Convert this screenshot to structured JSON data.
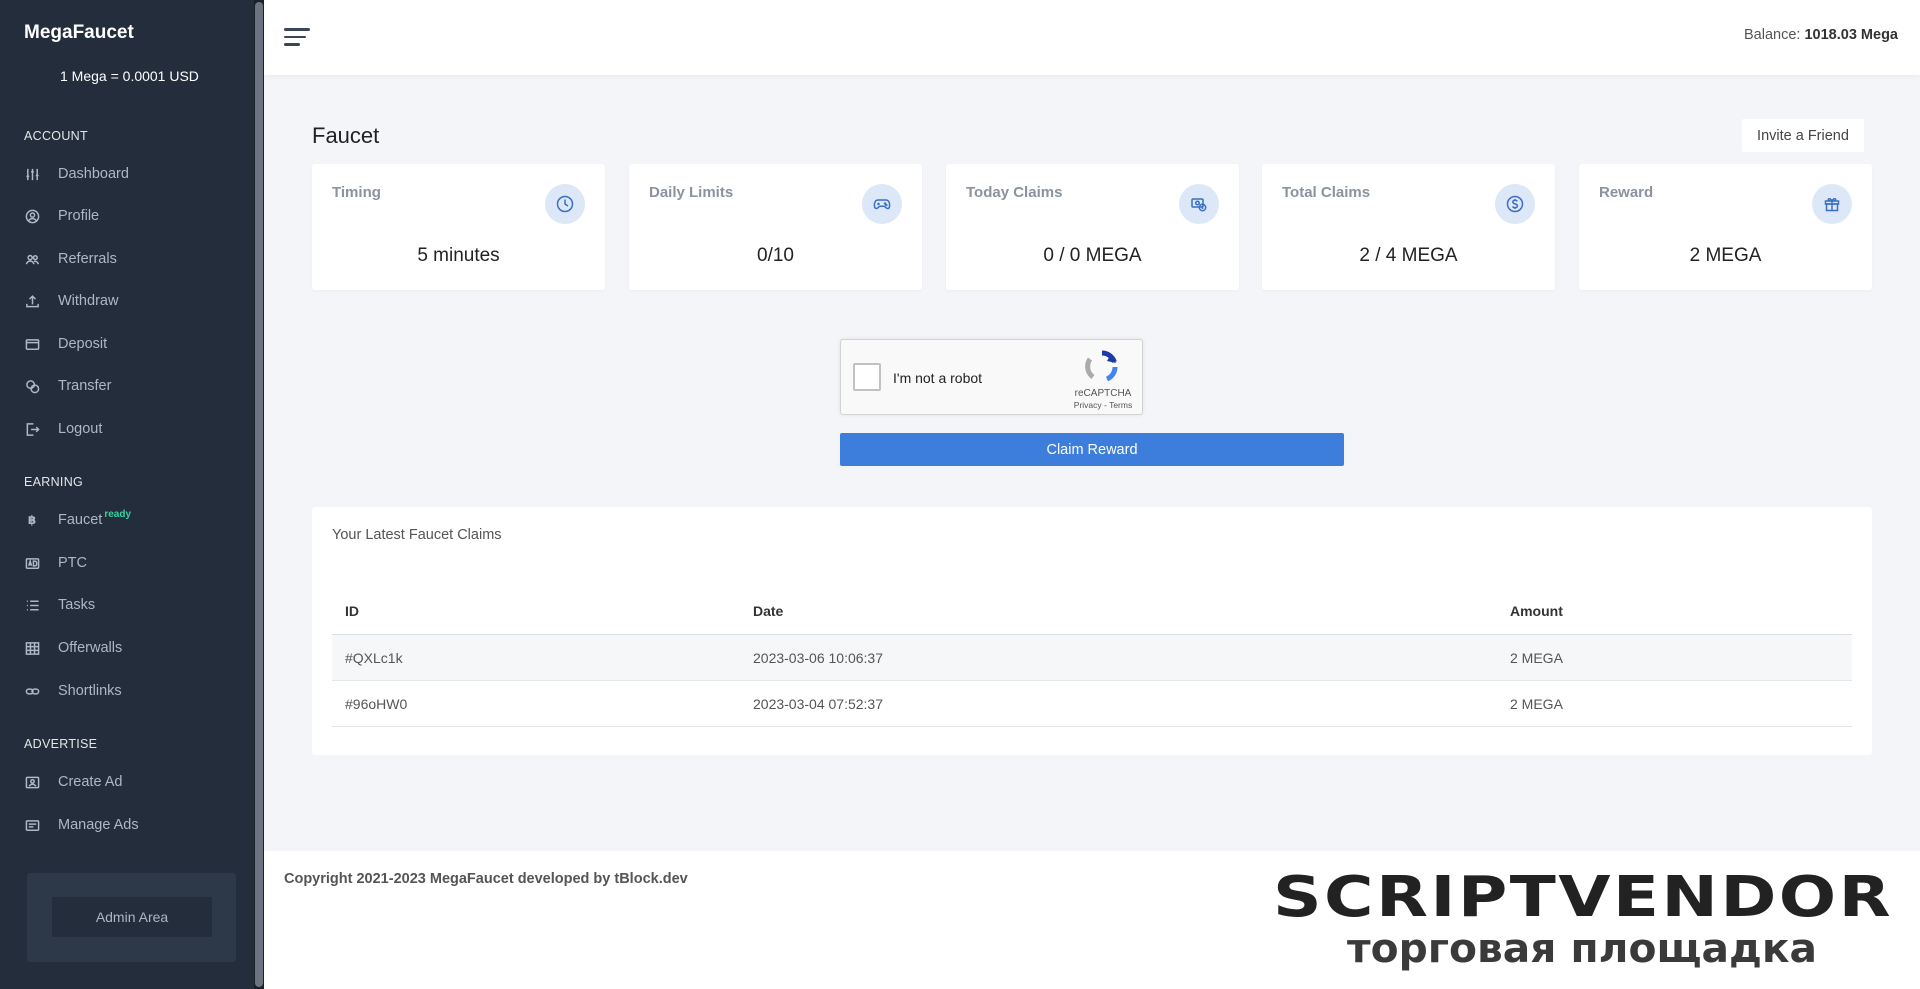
{
  "sidebar": {
    "brand": "MegaFaucet",
    "rate": "1 Mega = 0.0001 USD",
    "sections": {
      "account": "ACCOUNT",
      "earning": "EARNING",
      "advertise": "ADVERTISE"
    },
    "items": {
      "dashboard": "Dashboard",
      "profile": "Profile",
      "referrals": "Referrals",
      "withdraw": "Withdraw",
      "deposit": "Deposit",
      "transfer": "Transfer",
      "logout": "Logout",
      "faucet": "Faucet",
      "faucet_badge": "ready",
      "ptc": "PTC",
      "tasks": "Tasks",
      "offerwalls": "Offerwalls",
      "shortlinks": "Shortlinks",
      "create_ad": "Create Ad",
      "manage_ads": "Manage Ads"
    },
    "admin_button": "Admin Area"
  },
  "topbar": {
    "balance_label": "Balance:",
    "balance_value": "1018.03 Mega"
  },
  "page": {
    "title": "Faucet",
    "invite_button": "Invite a Friend"
  },
  "cards": [
    {
      "title": "Timing",
      "value": "5 minutes",
      "icon": "clock-icon"
    },
    {
      "title": "Daily Limits",
      "value": "0/10",
      "icon": "gamepad-icon"
    },
    {
      "title": "Today Claims",
      "value": "0 / 0 MEGA",
      "icon": "money-icon"
    },
    {
      "title": "Total Claims",
      "value": "2 / 4 MEGA",
      "icon": "dollar-coin-icon"
    },
    {
      "title": "Reward",
      "value": "2 MEGA",
      "icon": "gift-icon"
    }
  ],
  "captcha": {
    "label": "I'm not a robot",
    "brand": "reCAPTCHA",
    "links": "Privacy - Terms"
  },
  "claim_button": "Claim Reward",
  "claims": {
    "title": "Your Latest Faucet Claims",
    "headers": [
      "ID",
      "Date",
      "Amount"
    ],
    "rows": [
      [
        "#QXLc1k",
        "2023-03-06 10:06:37",
        "2 MEGA"
      ],
      [
        "#96oHW0",
        "2023-03-04 07:52:37",
        "2 MEGA"
      ]
    ]
  },
  "footer": {
    "copyright": "Copyright 2021-2023 MegaFaucet developed by tBlock.dev"
  },
  "watermark": {
    "line1": "SCRIPTVENDOR",
    "line2": "торговая площадка"
  },
  "colors": {
    "sidebar_bg": "#232d3b",
    "accent": "#3d7ddb",
    "ready_badge": "#38d39f",
    "icon_circle": "#dce7f7"
  }
}
